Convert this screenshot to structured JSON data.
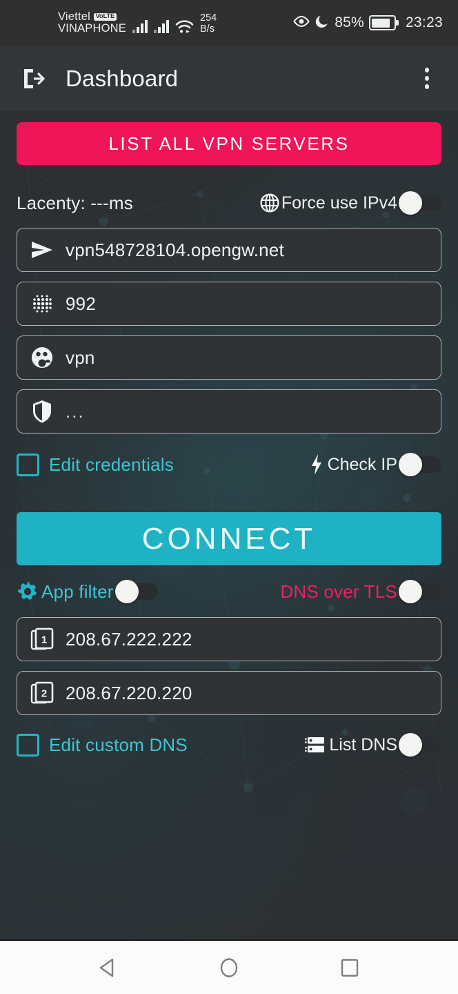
{
  "status_bar": {
    "carrier_primary": "Viettel",
    "volte_badge": "VoLTE",
    "carrier_secondary": "VINAPHONE",
    "network_speed_value": "254",
    "network_speed_unit": "B/s",
    "battery_percent": "85%",
    "clock": "23:23",
    "icons": [
      "signal-bars-icon",
      "signal-bars-icon",
      "wifi-icon",
      "eye-icon",
      "moon-icon",
      "battery-icon"
    ]
  },
  "app_bar": {
    "back_icon": "exit-to-app-icon",
    "title": "Dashboard",
    "overflow_icon": "more-vertical-icon"
  },
  "main": {
    "list_servers_button": "LIST ALL VPN SERVERS",
    "latency_label": "Lacenty: ---ms",
    "force_ipv4": {
      "label": "Force use IPv4",
      "icon": "globe-icon",
      "state": "off"
    },
    "server_field": {
      "icon": "send-icon",
      "value": "vpn548728104.opengw.net"
    },
    "port_field": {
      "icon": "dots-grid-icon",
      "value": "992"
    },
    "username_field": {
      "icon": "people-icon",
      "value": "vpn"
    },
    "password_field": {
      "icon": "shield-icon",
      "value": "..."
    },
    "edit_credentials": {
      "label": "Edit credentials",
      "checked": false
    },
    "check_ip": {
      "label": "Check IP",
      "icon": "lightning-bolt-icon",
      "state": "off"
    },
    "connect_button": "CONNECT",
    "app_filter": {
      "label": "App filter",
      "icon": "gear-icon",
      "state": "off"
    },
    "dns_over_tls": {
      "label": "DNS over TLS",
      "state": "off"
    },
    "dns1_field": {
      "icon": "dns-one-icon",
      "value": "208.67.222.222"
    },
    "dns2_field": {
      "icon": "dns-two-icon",
      "value": "208.67.220.220"
    },
    "edit_custom_dns": {
      "label": "Edit custom DNS",
      "checked": false
    },
    "list_dns": {
      "label": "List DNS",
      "icon": "server-list-icon",
      "state": "off"
    }
  },
  "nav_bar": {
    "back": "back-triangle-icon",
    "home": "home-circle-icon",
    "recents": "recents-square-icon"
  },
  "colors": {
    "pink": "#ee1559",
    "teal": "#1fb2c4",
    "teal_text": "#3fc4d2",
    "field_bg": "#303335",
    "bg": "#2b3034"
  }
}
